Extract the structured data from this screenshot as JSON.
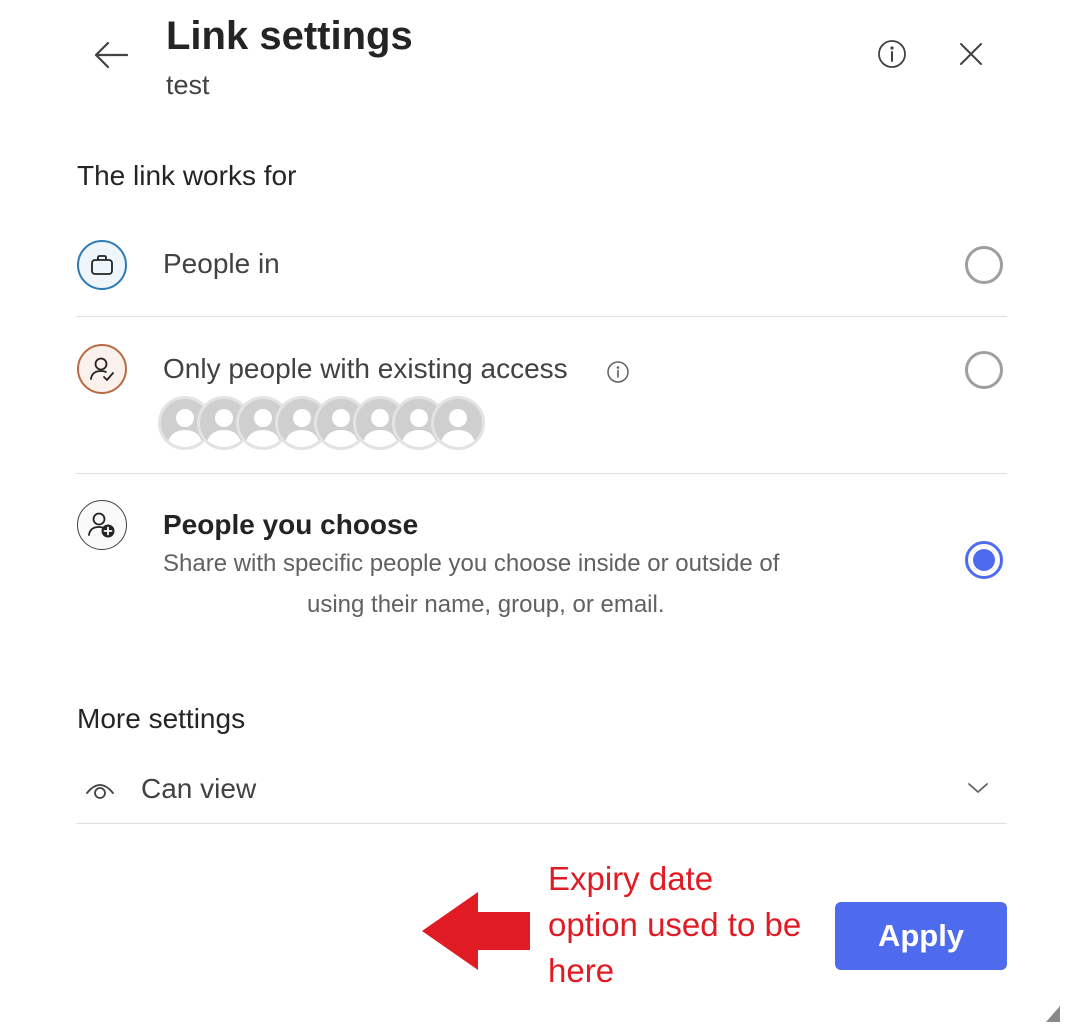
{
  "header": {
    "title": "Link settings",
    "subtitle": "test"
  },
  "link_works_for": {
    "heading": "The link works for",
    "options": [
      {
        "label": "People in",
        "icon": "briefcase-icon",
        "selected": false
      },
      {
        "label": "Only people with existing access",
        "icon": "person-check-icon",
        "selected": false,
        "avatar_count": 8
      },
      {
        "label": "People you choose",
        "icon": "person-add-icon",
        "selected": true,
        "description_line1": "Share with specific people you choose inside or outside of",
        "description_line2": "using their name, group, or email."
      }
    ]
  },
  "more_settings": {
    "heading": "More settings",
    "permission": {
      "label": "Can view",
      "icon": "eye-icon"
    }
  },
  "footer": {
    "apply_label": "Apply"
  },
  "annotation": {
    "line1": "Expiry date",
    "line2": "option used to be",
    "line3": "here",
    "color": "#e01b24"
  },
  "colors": {
    "accent": "#4f6bed",
    "briefcase_ring": "#2e7bb5",
    "person_check_ring": "#b86a45",
    "annotation_red": "#e01b24"
  }
}
